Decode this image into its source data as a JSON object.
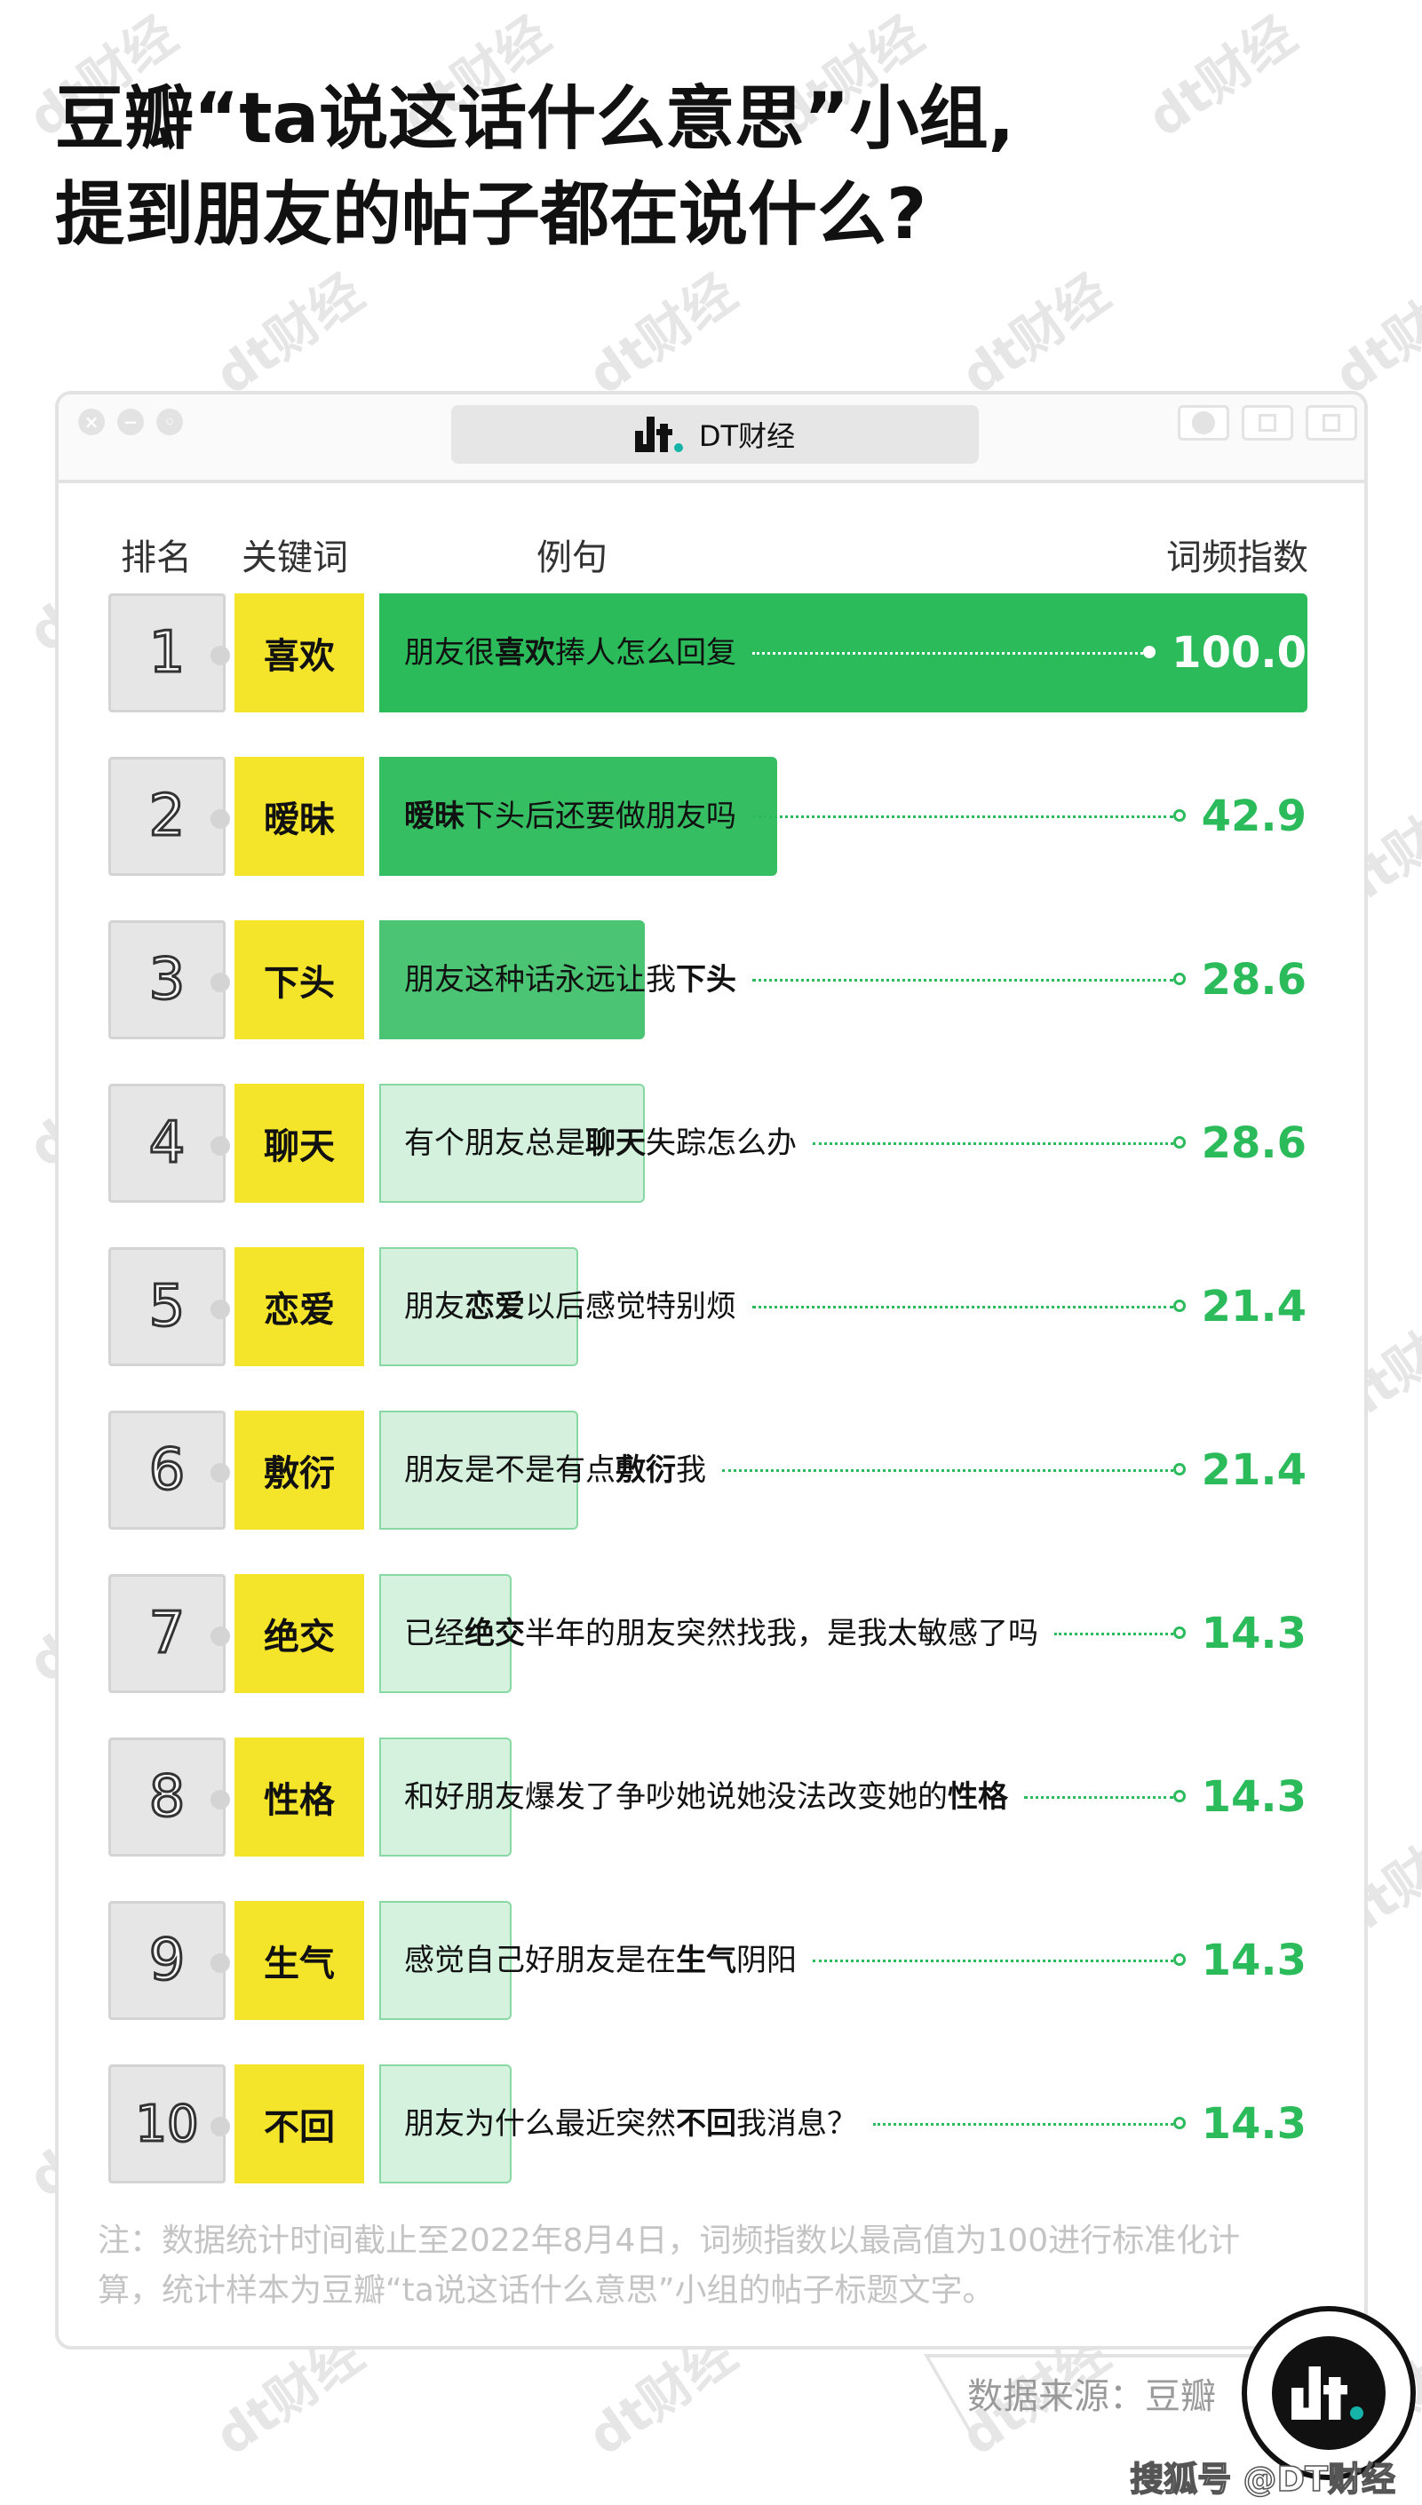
{
  "title": {
    "line1": "豆瓣“ta说这话什么意思”小组,",
    "line2": "提到朋友的帖子都在说什么?"
  },
  "window": {
    "tab_title": "DT财经",
    "logo_icon": "dt-logo-icon"
  },
  "watermark_text": "dt财经",
  "columns": {
    "rank": "排名",
    "keyword": "关键词",
    "example": "例句",
    "index": "词频指数"
  },
  "colors": {
    "green": "#2bbb5b",
    "yellow": "#f5e52a",
    "rank_bg": "#e6e6e6"
  },
  "chart_data": {
    "type": "bar",
    "xlim": [
      0,
      100
    ],
    "columns": [
      "排名",
      "关键词",
      "例句",
      "词频指数"
    ],
    "rows": [
      {
        "rank": "1",
        "keyword": "喜欢",
        "pre": "朋友很",
        "post": "捧人怎么回复",
        "value": 100.0
      },
      {
        "rank": "2",
        "keyword": "暧昧",
        "pre": "",
        "post": "下头后还要做朋友吗",
        "value": 42.9
      },
      {
        "rank": "3",
        "keyword": "下头",
        "pre": "朋友这种话永远让我",
        "post": "",
        "value": 28.6
      },
      {
        "rank": "4",
        "keyword": "聊天",
        "pre": "有个朋友总是",
        "post": "失踪怎么办",
        "value": 28.6
      },
      {
        "rank": "5",
        "keyword": "恋爱",
        "pre": "朋友",
        "post": "以后感觉特别烦",
        "value": 21.4
      },
      {
        "rank": "6",
        "keyword": "敷衍",
        "pre": "朋友是不是有点",
        "post": "我",
        "value": 21.4
      },
      {
        "rank": "7",
        "keyword": "绝交",
        "pre": "已经",
        "post": "半年的朋友突然找我，是我太敏感了吗",
        "value": 14.3
      },
      {
        "rank": "8",
        "keyword": "性格",
        "pre": "和好朋友爆发了争吵她说她没法改变她的",
        "post": "",
        "value": 14.3
      },
      {
        "rank": "9",
        "keyword": "生气",
        "pre": "感觉自己好朋友是在",
        "post": "阴阳",
        "value": 14.3
      },
      {
        "rank": "10",
        "keyword": "不回",
        "pre": "朋友为什么最近突然",
        "post": "我消息？",
        "value": 14.3
      }
    ]
  },
  "note": {
    "text": "注：数据统计时间截止至2022年8月4日，词频指数以最高值为100进行标准化计算，统计样本为豆瓣“ta说这话什么意思”小组的帖子标题文字。"
  },
  "source": "数据来源：豆瓣",
  "footer": "搜狐号 @DT财经"
}
